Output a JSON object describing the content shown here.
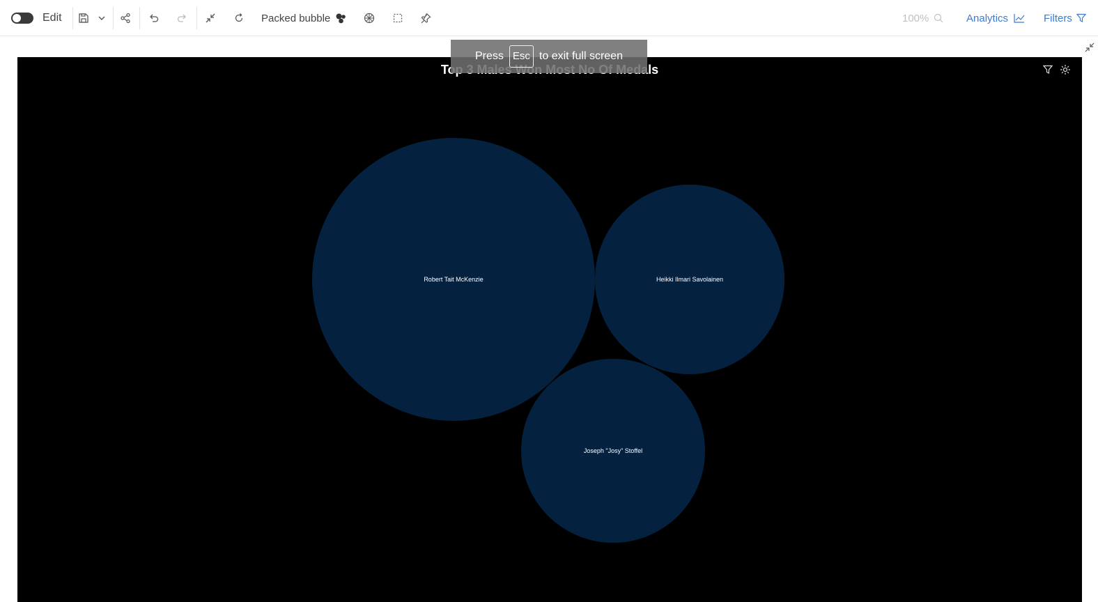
{
  "toolbar": {
    "edit_label": "Edit",
    "chart_type_label": "Packed bubble",
    "zoom_value": "100%",
    "analytics_label": "Analytics",
    "filters_label": "Filters"
  },
  "fullscreen_banner": {
    "prefix": "Press",
    "key": "Esc",
    "suffix": "to exit full screen"
  },
  "colors": {
    "canvas_bg": "#000000",
    "bubble_fill": "#04223f",
    "link_blue": "#3b7bd4"
  },
  "chart_data": {
    "type": "packed-bubble",
    "title": "Top 3 Males Won Most No Of Medals",
    "bubbles": [
      {
        "label": "Robert Tait McKenzie"
      },
      {
        "label": "Heikki Ilmari Savolainen"
      },
      {
        "label": "Joseph \"Josy\" Stoffel"
      }
    ]
  }
}
